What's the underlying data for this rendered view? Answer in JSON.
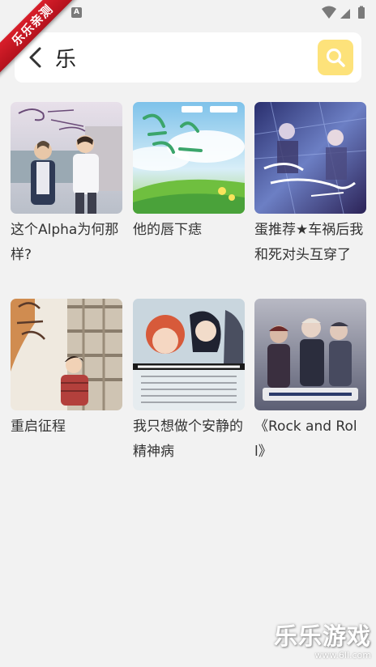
{
  "ribbon": {
    "text": "乐乐亲测"
  },
  "status_bar": {
    "notification_glyph": "A",
    "icons": [
      "wifi-icon",
      "signal-icon",
      "battery-icon"
    ]
  },
  "search": {
    "back_icon": "chevron-left-icon",
    "query": "乐",
    "search_icon": "search-icon",
    "button_color": "#fde27a"
  },
  "results": [
    {
      "title": "这个Alpha为何那样?"
    },
    {
      "title": "他的唇下痣"
    },
    {
      "title": "蛋推荐★车祸后我和死对头互穿了"
    },
    {
      "title": "重启征程"
    },
    {
      "title": "我只想做个安静的精神病"
    },
    {
      "title": "《Rock and Roll》"
    }
  ],
  "watermark": {
    "text": "乐乐游戏",
    "url": "www.6ll.com"
  }
}
